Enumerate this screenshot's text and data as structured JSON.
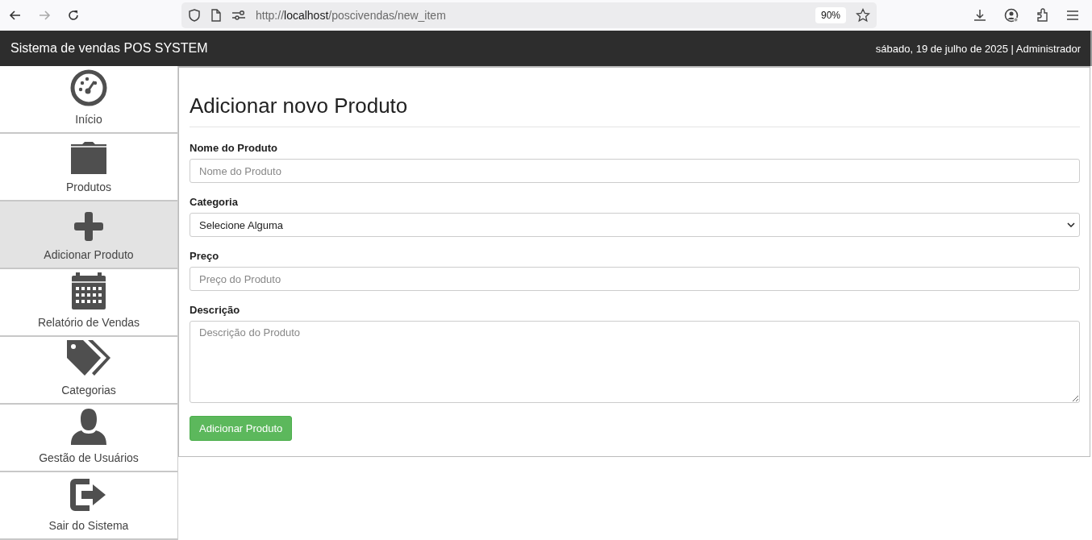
{
  "browser": {
    "url_prefix": "http://",
    "url_host": "localhost",
    "url_path": "/poscivendas/new_item",
    "zoom": "90%"
  },
  "header": {
    "title": "Sistema de vendas POS SYSTEM",
    "info": "sábado, 19 de julho de 2025 | Administrador"
  },
  "sidebar": {
    "items": [
      {
        "label": "Início",
        "kind": "dashboard",
        "selected": false
      },
      {
        "label": "Produtos",
        "kind": "folder",
        "selected": false
      },
      {
        "label": "Adicionar Produto",
        "kind": "plus",
        "selected": true
      },
      {
        "label": "Relatório de Vendas",
        "kind": "calendar",
        "selected": false
      },
      {
        "label": "Categorias",
        "kind": "tags",
        "selected": false
      },
      {
        "label": "Gestão de Usuários",
        "kind": "user",
        "selected": false
      },
      {
        "label": "Sair do Sistema",
        "kind": "logout",
        "selected": false
      }
    ]
  },
  "form": {
    "title": "Adicionar novo Produto",
    "fields": [
      {
        "label": "Nome do Produto",
        "kind": "text",
        "placeholder": "Nome do Produto"
      },
      {
        "label": "Categoria",
        "kind": "select",
        "value": "Selecione Alguma"
      },
      {
        "label": "Preço",
        "kind": "text",
        "placeholder": "Preço do Produto"
      },
      {
        "label": "Descrição",
        "kind": "textarea",
        "placeholder": "Descrição do Produto"
      }
    ],
    "submit": "Adicionar Produto"
  }
}
